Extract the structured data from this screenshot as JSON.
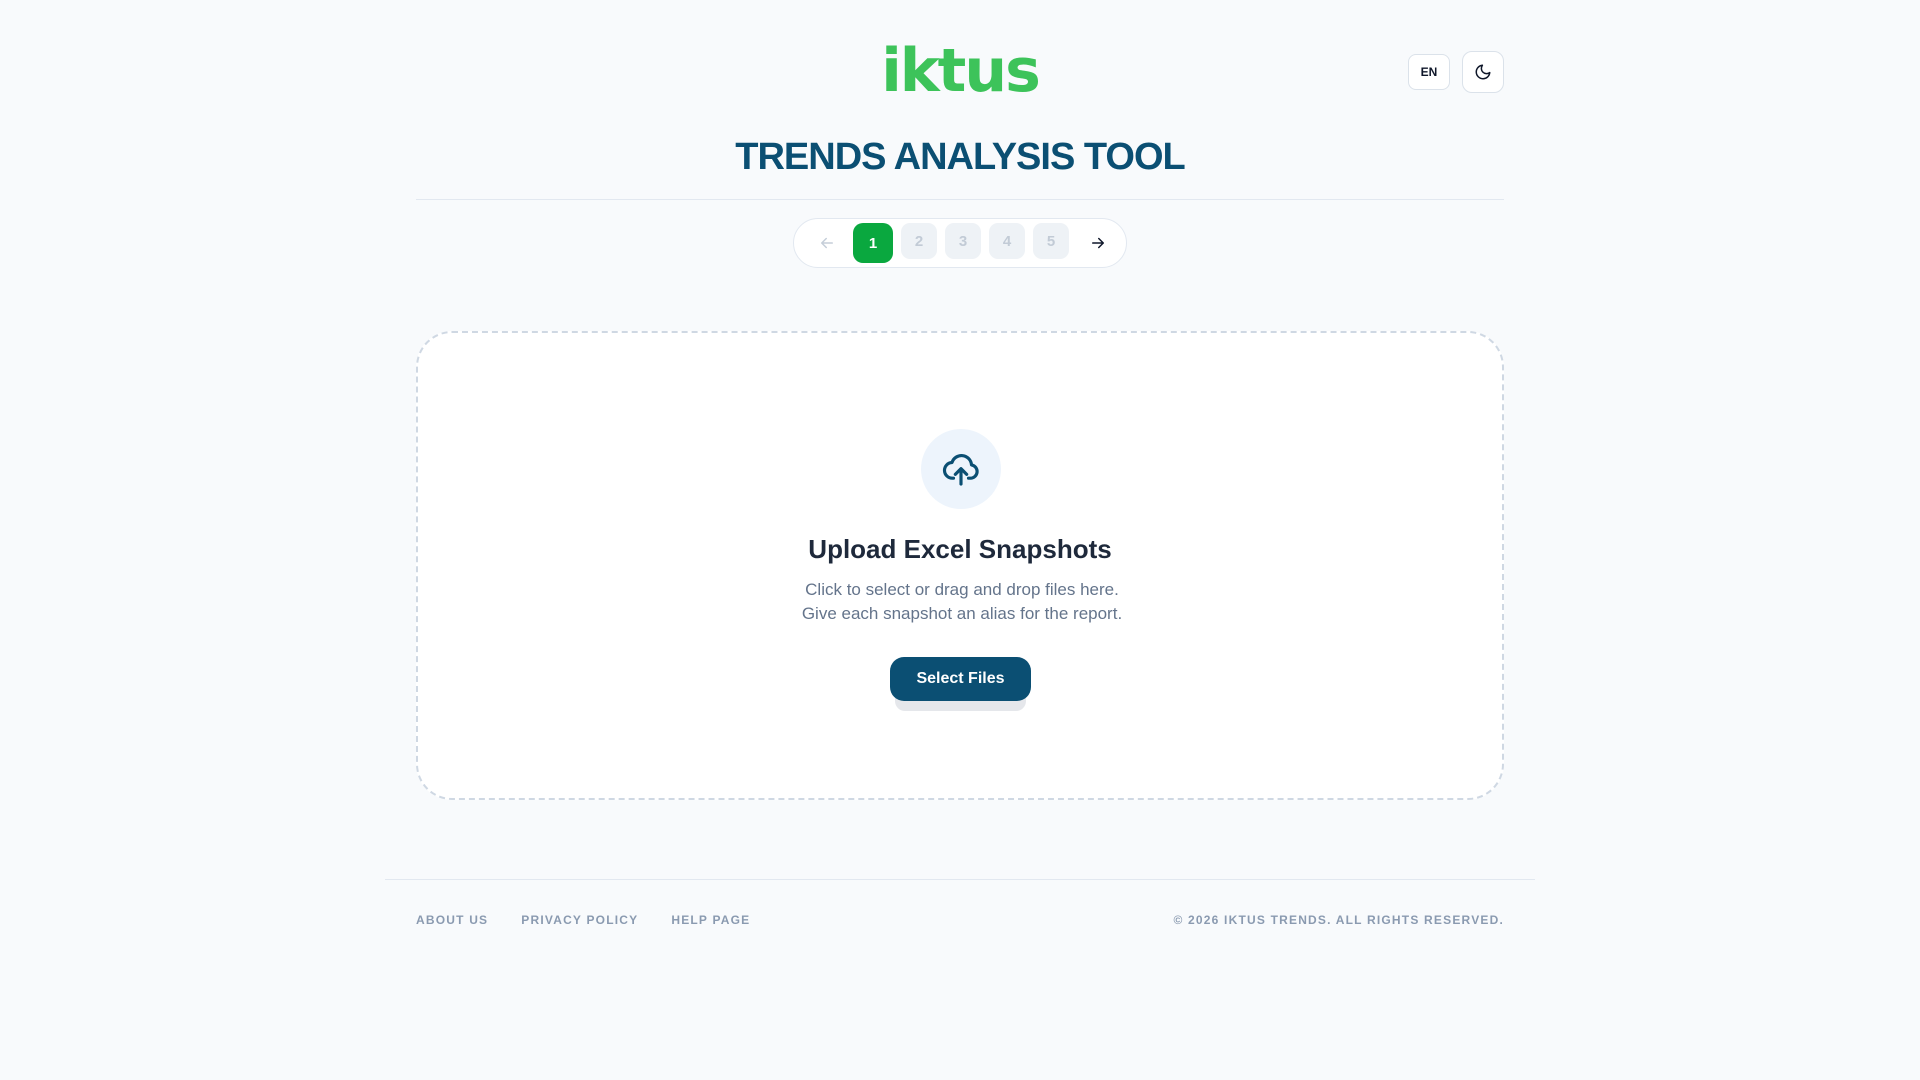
{
  "header": {
    "logo_text": "iktus",
    "language": "EN",
    "title": "TRENDS ANALYSIS TOOL"
  },
  "stepper": {
    "steps": [
      "1",
      "2",
      "3",
      "4",
      "5"
    ],
    "active_step": 1
  },
  "upload": {
    "title": "Upload Excel Snapshots",
    "description": "Click to select or drag and drop files here. Give each snapshot an alias for the report.",
    "button_label": "Select Files"
  },
  "footer": {
    "links": [
      "ABOUT US",
      "PRIVACY POLICY",
      "HELP PAGE"
    ],
    "copyright": "© 2026 IKTUS TRENDS. ALL RIGHTS RESERVED."
  },
  "colors": {
    "brand_green": "#3dc35a",
    "active_step": "#0aa83f",
    "primary_navy": "#0b4f73",
    "background": "#f8fafc"
  },
  "icons": {
    "back": "arrow-left-icon",
    "forward": "arrow-right-icon",
    "theme": "moon-icon",
    "upload": "cloud-upload-icon"
  }
}
